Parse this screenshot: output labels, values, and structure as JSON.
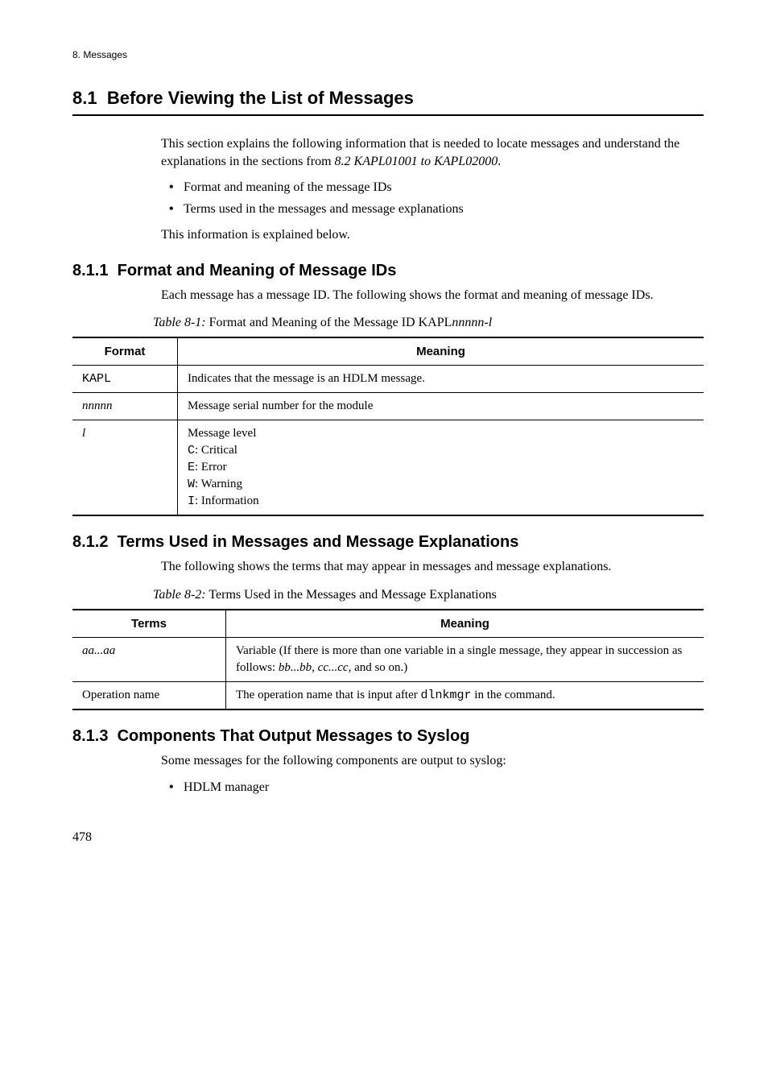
{
  "header": {
    "chapter_label": "8. Messages"
  },
  "section": {
    "number": "8.1",
    "title": "Before Viewing the List of Messages"
  },
  "intro": {
    "p1_prefix": "This section explains the following information that is needed to locate messages and understand the explanations in the sections from ",
    "p1_italic": "8.2  KAPL01001 to KAPL02000",
    "p1_suffix": ".",
    "bullets": [
      "Format and meaning of the message IDs",
      "Terms used in the messages and message explanations"
    ],
    "p2": "This information is explained below."
  },
  "sub1": {
    "number": "8.1.1",
    "title": "Format and Meaning of Message IDs",
    "p1": "Each message has a message ID. The following shows the format and meaning of message IDs.",
    "table_caption_prefix": "Table  8-1:",
    "table_caption_text": "  Format and Meaning of the Message ID KAPL",
    "table_caption_italic": "nnnnn-l",
    "table": {
      "headers": [
        "Format",
        "Meaning"
      ],
      "rows": [
        {
          "format_mono": "KAPL",
          "format_italic": "",
          "meaning_plain": "Indicates that the message is an HDLM message.",
          "meaning_lines": []
        },
        {
          "format_mono": "",
          "format_italic": "nnnnn",
          "meaning_plain": "Message serial number for the module",
          "meaning_lines": []
        },
        {
          "format_mono": "",
          "format_italic": "l",
          "meaning_plain": "Message level",
          "meaning_lines": [
            {
              "code": "C",
              "text": ": Critical"
            },
            {
              "code": "E",
              "text": ": Error"
            },
            {
              "code": "W",
              "text": ": Warning"
            },
            {
              "code": "I",
              "text": ": Information"
            }
          ]
        }
      ]
    }
  },
  "sub2": {
    "number": "8.1.2",
    "title": "Terms Used in Messages and Message Explanations",
    "p1": "The following shows the terms that may appear in messages and message explanations.",
    "table_caption_prefix": "Table  8-2:",
    "table_caption_text": "  Terms Used in the Messages and Message Explanations",
    "table": {
      "headers": [
        "Terms",
        "Meaning"
      ],
      "rows": [
        {
          "term_italic": "aa...aa",
          "term_plain": "",
          "meaning_pre": "Variable (If there is more than one variable in a single message, they appear in succession as follows: ",
          "meaning_italic": "bb...bb",
          "meaning_mid": ", ",
          "meaning_italic2": "cc...cc",
          "meaning_post": ", and so on.)"
        },
        {
          "term_italic": "",
          "term_plain": "Operation name",
          "meaning_pre": "The operation name that is input after ",
          "meaning_mono": "dlnkmgr",
          "meaning_post": " in the command."
        }
      ]
    }
  },
  "sub3": {
    "number": "8.1.3",
    "title": "Components That Output Messages to Syslog",
    "p1": "Some messages for the following components are output to syslog:",
    "bullets": [
      "HDLM manager"
    ]
  },
  "page_number": "478",
  "chart_data": {
    "type": "table",
    "tables": [
      {
        "title": "Table 8-1: Format and Meaning of the Message ID KAPLnnnnn-l",
        "columns": [
          "Format",
          "Meaning"
        ],
        "rows": [
          [
            "KAPL",
            "Indicates that the message is an HDLM message."
          ],
          [
            "nnnnn",
            "Message serial number for the module"
          ],
          [
            "l",
            "Message level; C: Critical; E: Error; W: Warning; I: Information"
          ]
        ]
      },
      {
        "title": "Table 8-2: Terms Used in the Messages and Message Explanations",
        "columns": [
          "Terms",
          "Meaning"
        ],
        "rows": [
          [
            "aa...aa",
            "Variable (If there is more than one variable in a single message, they appear in succession as follows: bb...bb, cc...cc, and so on.)"
          ],
          [
            "Operation name",
            "The operation name that is input after dlnkmgr in the command."
          ]
        ]
      }
    ]
  }
}
